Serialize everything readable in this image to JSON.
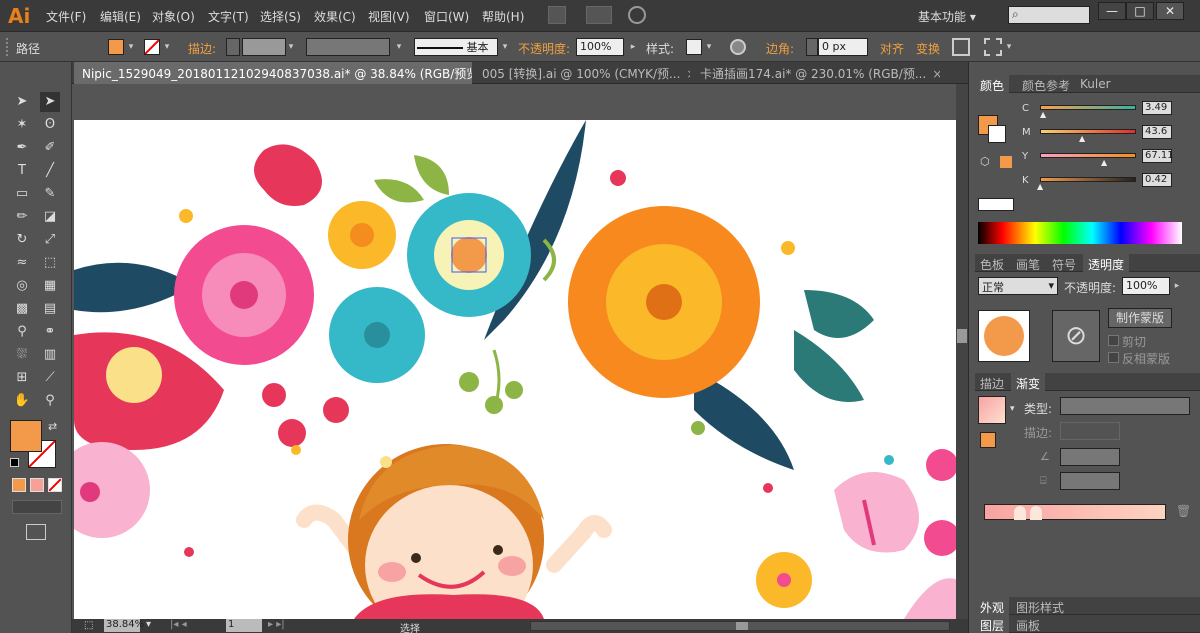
{
  "app": {
    "logo": "Ai"
  },
  "menu": [
    "文件(F)",
    "编辑(E)",
    "对象(O)",
    "文字(T)",
    "选择(S)",
    "效果(C)",
    "视图(V)",
    "窗口(W)",
    "帮助(H)"
  ],
  "workspace": "基本功能",
  "window_controls": {
    "minimize": "—",
    "maximize": "□",
    "close": "✕"
  },
  "control": {
    "selection": "路径",
    "stroke_label": "描边:",
    "stroke_profile": "基本",
    "opacity_label": "不透明度:",
    "opacity_value": "100%",
    "style_label": "样式:",
    "corner_label": "边角:",
    "corner_value": "0 px",
    "align_label": "对齐",
    "transform_label": "变换"
  },
  "tabs": [
    {
      "label": "Nipic_1529049_20180112102940837038.ai* @ 38.84% (RGB/预览)",
      "close": "×"
    },
    {
      "label": "005 [转换].ai @ 100% (CMYK/预...",
      "close": "×"
    },
    {
      "label": "卡通插画174.ai* @ 230.01% (RGB/预...",
      "close": "×"
    }
  ],
  "status": {
    "zoom": "38.84%",
    "page": "1",
    "mode": "选择"
  },
  "color_panel": {
    "tabs": [
      "颜色",
      "颜色参考",
      "Kuler"
    ],
    "channels": [
      {
        "name": "C",
        "value": "3.49",
        "level": 0.035
      },
      {
        "name": "M",
        "value": "43.6",
        "level": 0.436
      },
      {
        "name": "Y",
        "value": "67.11",
        "level": 0.671
      },
      {
        "name": "K",
        "value": "0.42",
        "level": 0.004
      }
    ]
  },
  "transparency_panel": {
    "tabs": [
      "色板",
      "画笔",
      "符号",
      "透明度"
    ],
    "mode": "正常",
    "opacity_label": "不透明度:",
    "opacity_value": "100%",
    "mask_button": "制作蒙版",
    "clip_label": "剪切",
    "invert_label": "反相蒙版"
  },
  "gradient_panel": {
    "tabs": [
      "描边",
      "渐变"
    ],
    "type_label": "类型:",
    "stroke_label": "描边:"
  },
  "bottom_tabs": [
    "外观",
    "图形样式"
  ],
  "layers_tabs": [
    "图层",
    "画板"
  ],
  "colors": {
    "fill": "#f39a4a",
    "accent": "#f0a040"
  }
}
